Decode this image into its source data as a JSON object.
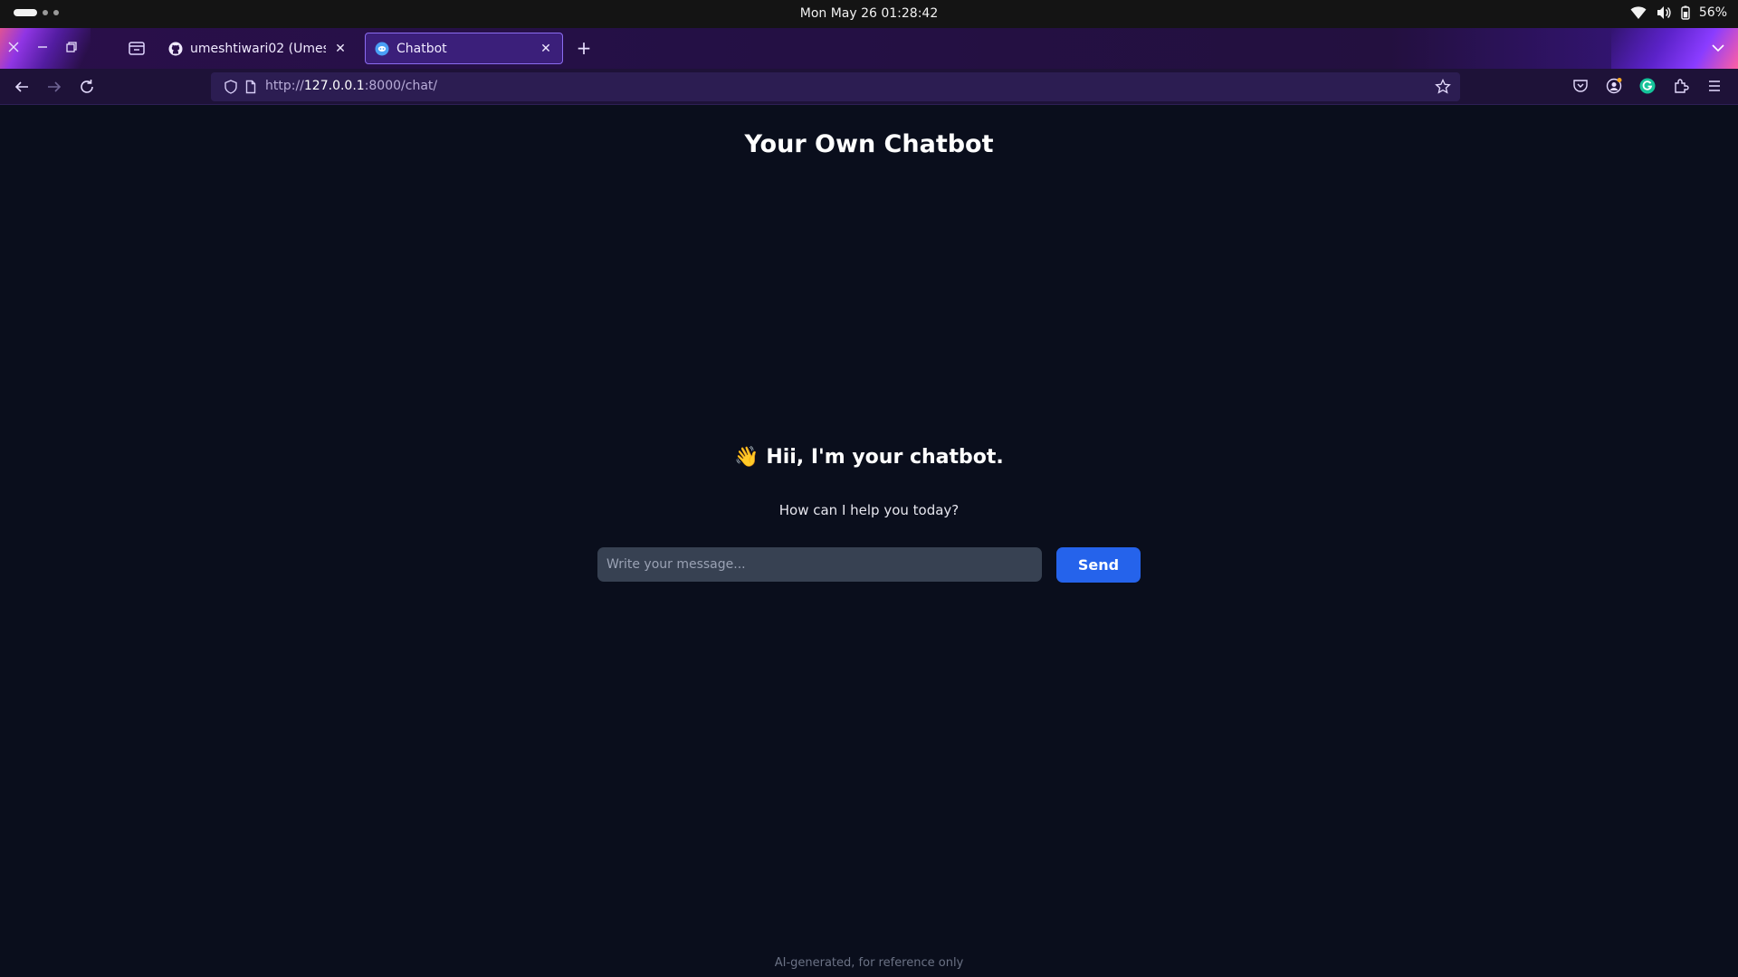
{
  "system": {
    "datetime": "Mon May 26  01:28:42",
    "battery": "56%"
  },
  "browser": {
    "tabs": [
      {
        "label": "umeshtiwari02 (Umesh Ti",
        "icon": "github-icon",
        "active": false
      },
      {
        "label": "Chatbot",
        "icon": "chatbot-favicon-icon",
        "active": true
      }
    ],
    "url_prefix": "http://",
    "url_host": "127.0.0.1",
    "url_rest": ":8000/chat/"
  },
  "page": {
    "title": "Your Own Chatbot",
    "greeting_emoji": "👋",
    "greeting": "Hii, I'm your chatbot.",
    "subtitle": "How can I help you today?",
    "input_placeholder": "Write your message...",
    "send_label": "Send",
    "footer_note": "AI-generated, for reference only"
  },
  "colors": {
    "page_bg": "#0a0e1c",
    "send_button": "#2563eb",
    "input_bg": "#374152",
    "tab_active_border": "#8b6cf0"
  }
}
